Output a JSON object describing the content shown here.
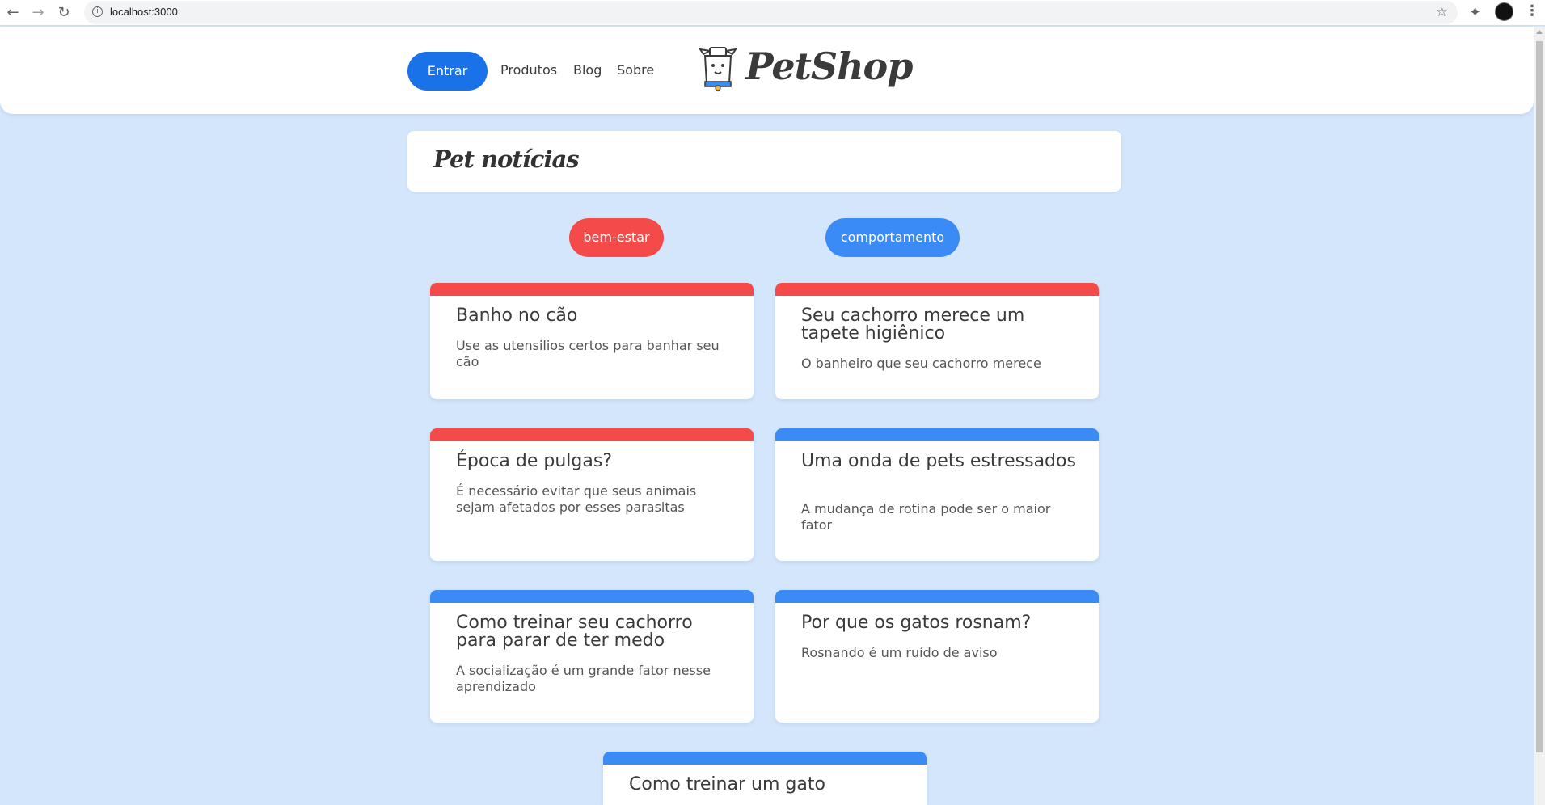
{
  "browser": {
    "url": "localhost:3000",
    "back_icon": "arrow-left-icon",
    "forward_icon": "arrow-right-icon",
    "reload_icon": "reload-icon",
    "info_icon": "info-icon",
    "star_icon": "star-icon",
    "extensions_icon": "puzzle-icon",
    "menu_icon": "kebab-menu-icon"
  },
  "header": {
    "login_label": "Entrar",
    "nav": [
      "Produtos",
      "Blog",
      "Sobre"
    ],
    "logo_text": "PetShop",
    "logo_icon": "dog-logo-icon"
  },
  "page": {
    "title": "Pet notícias"
  },
  "categories": [
    {
      "label": "bem-estar",
      "color": "#f44a4a"
    },
    {
      "label": "comportamento",
      "color": "#3a8bf5"
    }
  ],
  "posts": [
    {
      "title": "Banho no cão",
      "description": "Use as utensilios certos para banhar seu cão",
      "category": "bem-estar"
    },
    {
      "title": "Seu cachorro merece um tapete higiênico",
      "description": "O banheiro que seu cachorro merece",
      "category": "bem-estar"
    },
    {
      "title": "Época de pulgas?",
      "description": "É necessário evitar que seus animais sejam afetados por esses parasitas",
      "category": "bem-estar"
    },
    {
      "title": "Uma onda de pets estressados",
      "description": "A mudança de rotina pode ser o maior fator",
      "category": "comportamento"
    },
    {
      "title": "Como treinar seu cachorro para parar de ter medo",
      "description": "A socialização é um grande fator nesse aprendizado",
      "category": "comportamento"
    },
    {
      "title": "Por que os gatos rosnam?",
      "description": "Rosnando é um ruído de aviso",
      "category": "comportamento"
    },
    {
      "title": "Como treinar um gato",
      "description": "",
      "category": "comportamento"
    }
  ],
  "colors": {
    "background": "#d3e6fc",
    "primary": "#1a72e8",
    "bem_estar": "#f44a4a",
    "comportamento": "#3a8bf5"
  }
}
